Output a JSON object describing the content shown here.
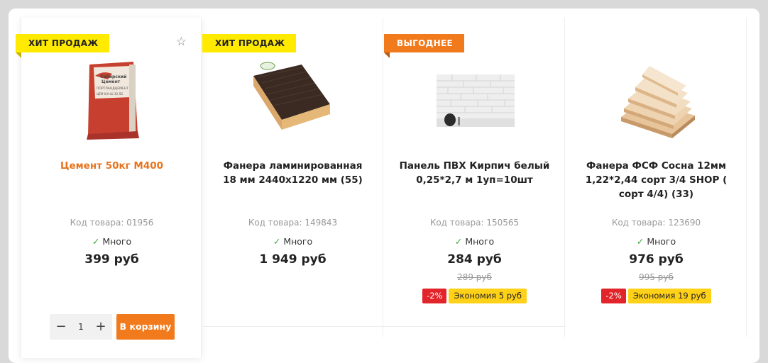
{
  "products": [
    {
      "badge": "ХИТ ПРОДАЖ",
      "title": "Цемент 50кг М400",
      "code": "Код товара: 01956",
      "stock": "Много",
      "price": "399 руб",
      "quantity": "1",
      "cart_label": "В корзину"
    },
    {
      "badge": "ХИТ ПРОДАЖ",
      "title": "Фанера ламинированная 18 мм 2440х1220 мм (55)",
      "code": "Код товара: 149843",
      "stock": "Много",
      "price": "1 949 руб"
    },
    {
      "badge": "ВЫГОДНЕЕ",
      "title": "Панель ПВХ Кирпич белый 0,25*2,7 м 1уп=10шт",
      "code": "Код товара: 150565",
      "stock": "Много",
      "price": "284 руб",
      "old_price": "289 руб",
      "discount_pct": "-2%",
      "savings": "Экономия 5 руб"
    },
    {
      "title": "Фанера ФСФ Сосна 12мм 1,22*2,44 сорт 3/4 SHOP ( сорт 4/4) (33)",
      "code": "Код товара: 123690",
      "stock": "Много",
      "price": "976 руб",
      "old_price": "995 руб",
      "discount_pct": "-2%",
      "savings": "Экономия 19 руб"
    }
  ],
  "cement_bag": {
    "brand_line1": "Сибирский",
    "brand_line2": "Цемент",
    "product_line": "ПОРТЛАНДЦЕМЕНТ",
    "grade": "ЦЕМ II/А-Ш 32,5Б"
  },
  "colors": {
    "accent_orange": "#f07a1c",
    "badge_yellow": "#ffea00",
    "discount_red": "#e1252a",
    "savings_yellow": "#ffd119",
    "stock_green": "#3aa635"
  },
  "icons": {
    "favorite": "star-outline-icon",
    "stock": "check-icon",
    "minus": "minus-icon",
    "plus": "plus-icon"
  }
}
